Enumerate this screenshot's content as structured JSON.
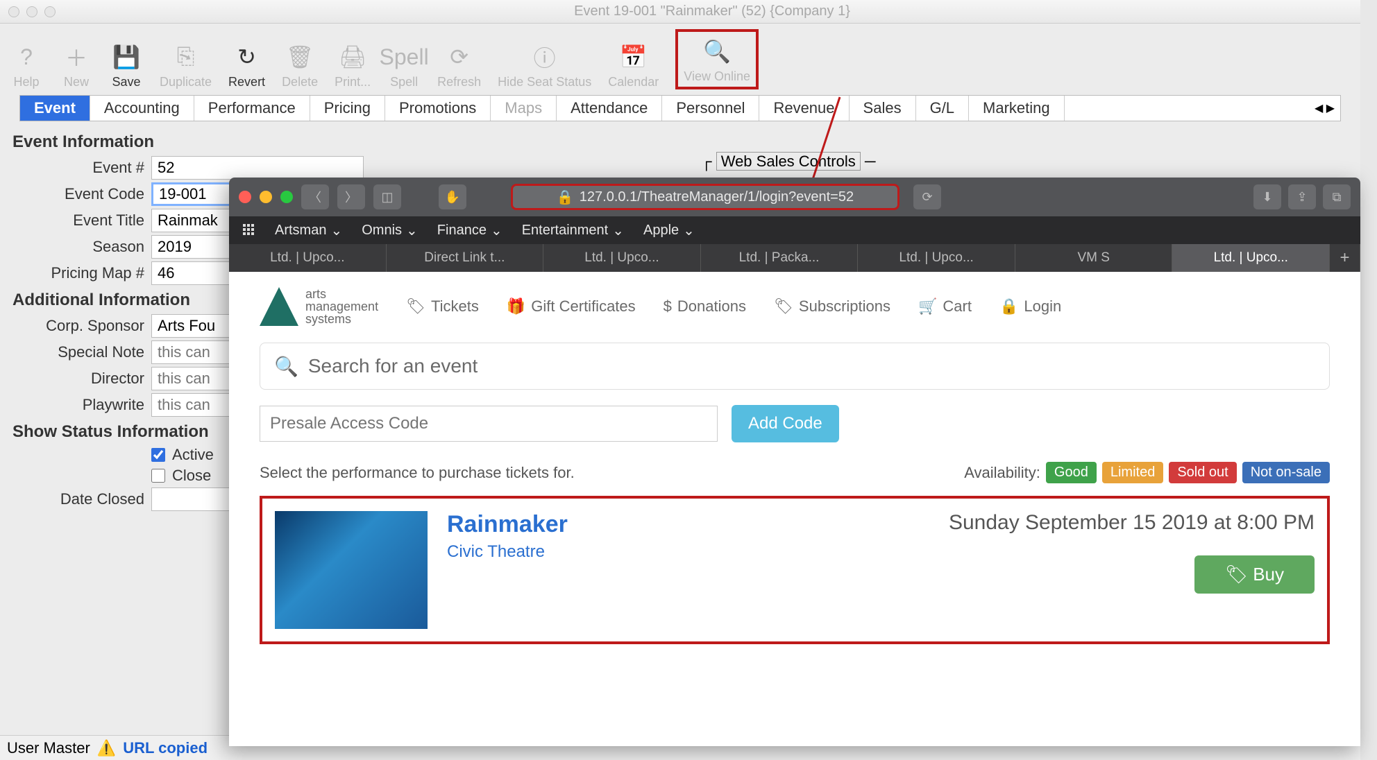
{
  "window": {
    "title": "Event 19-001 \"Rainmaker\" (52) {Company 1}"
  },
  "toolbar": [
    {
      "name": "help",
      "label": "Help",
      "enabled": false,
      "icon": "?"
    },
    {
      "name": "new",
      "label": "New",
      "enabled": false,
      "icon": "＋"
    },
    {
      "name": "save",
      "label": "Save",
      "enabled": true,
      "icon": "💾"
    },
    {
      "name": "duplicate",
      "label": "Duplicate",
      "enabled": false,
      "icon": "⎘"
    },
    {
      "name": "revert",
      "label": "Revert",
      "enabled": true,
      "icon": "↻"
    },
    {
      "name": "delete",
      "label": "Delete",
      "enabled": false,
      "icon": "🗑"
    },
    {
      "name": "print",
      "label": "Print...",
      "enabled": false,
      "icon": "🖨"
    },
    {
      "name": "spell",
      "label": "Spell",
      "enabled": false,
      "icon": "Spell"
    },
    {
      "name": "refresh",
      "label": "Refresh",
      "enabled": false,
      "icon": "⟳"
    },
    {
      "name": "hide-seat",
      "label": "Hide Seat Status",
      "enabled": false,
      "icon": "ⓘ"
    },
    {
      "name": "calendar",
      "label": "Calendar",
      "enabled": false,
      "icon": "📅"
    },
    {
      "name": "view-online",
      "label": "View Online",
      "enabled": false,
      "icon": "🔍",
      "highlight": true
    }
  ],
  "tabs": [
    "Event",
    "Accounting",
    "Performance",
    "Pricing",
    "Promotions",
    "Maps",
    "Attendance",
    "Personnel",
    "Revenue",
    "Sales",
    "G/L",
    "Marketing"
  ],
  "tabs_active": "Event",
  "tabs_disabled": [
    "Maps"
  ],
  "form": {
    "section1": "Event Information",
    "event_num_label": "Event #",
    "event_num": "52",
    "event_code_label": "Event Code",
    "event_code": "19-001",
    "event_title_label": "Event Title",
    "event_title": "Rainmak",
    "season_label": "Season",
    "season": "2019",
    "pricing_map_label": "Pricing Map #",
    "pricing_map": "46",
    "section2": "Additional Information",
    "corp_label": "Corp. Sponsor",
    "corp": "Arts Fou",
    "special_label": "Special Note",
    "special_ph": "this can",
    "director_label": "Director",
    "director_ph": "this can",
    "playwrite_label": "Playwrite",
    "playwrite_ph": "this can",
    "section3": "Show Status Information",
    "active_label": "Active",
    "closed_label": "Close",
    "date_closed_label": "Date Closed"
  },
  "websales_label": "Web Sales Controls",
  "footer": {
    "user": "User Master",
    "msg": "URL copied"
  },
  "browser": {
    "url": "127.0.0.1/TheatreManager/1/login?event=52",
    "favs": [
      "Artsman",
      "Omnis",
      "Finance",
      "Entertainment",
      "Apple"
    ],
    "tabs": [
      "Ltd. | Upco...",
      "Direct Link t...",
      "Ltd. | Upco...",
      "Ltd. | Packa...",
      "Ltd. | Upco...",
      "VM S",
      "Ltd. | Upco..."
    ],
    "active_tab": 6,
    "logo": {
      "l1": "arts",
      "l2": "management",
      "l3": "systems"
    },
    "nav": [
      "Tickets",
      "Gift Certificates",
      "Donations",
      "Subscriptions",
      "Cart",
      "Login"
    ],
    "nav_icons": [
      "🏷",
      "🎁",
      "$",
      "🏷",
      "🛒",
      "🔒"
    ],
    "search_ph": "Search for an event",
    "presale_ph": "Presale Access Code",
    "addcode": "Add Code",
    "select_text": "Select the performance to purchase tickets for.",
    "avail_label": "Availability:",
    "badges": [
      "Good",
      "Limited",
      "Sold out",
      "Not on-sale"
    ],
    "event": {
      "title": "Rainmaker",
      "venue": "Civic Theatre",
      "date": "Sunday September 15 2019 at 8:00 PM",
      "buy": "Buy"
    }
  }
}
